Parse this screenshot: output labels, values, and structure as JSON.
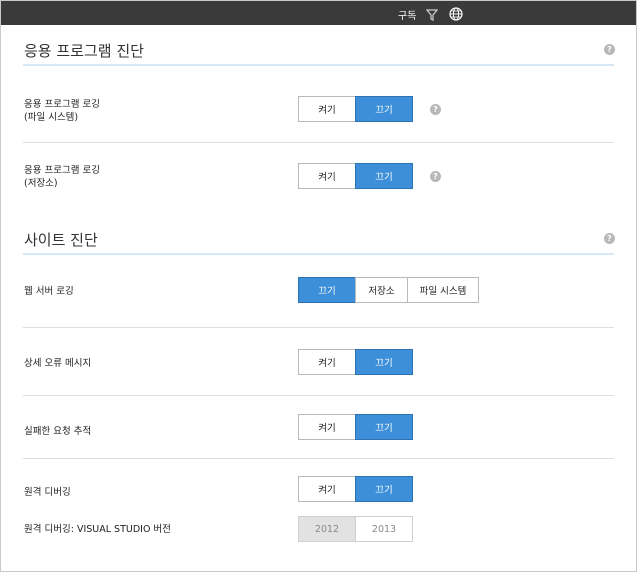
{
  "topbar": {
    "subscription_label": "구독"
  },
  "app_diag": {
    "title": "응용 프로그램 진단",
    "help": "?",
    "fs_logging": {
      "label_line1": "응용 프로그램 로깅",
      "label_line2": "(파일 시스템)",
      "on": "켜기",
      "off": "끄기",
      "selected": "off"
    },
    "blob_logging": {
      "label_line1": "응용 프로그램 로깅",
      "label_line2": "(저장소)",
      "on": "켜기",
      "off": "끄기",
      "selected": "off"
    }
  },
  "site_diag": {
    "title": "사이트 진단",
    "help": "?",
    "web_server_logging": {
      "label": "웹 서버 로깅",
      "opt_off": "끄기",
      "opt_storage": "저장소",
      "opt_fs": "파일 시스템",
      "selected": "off"
    },
    "detailed_errors": {
      "label": "상세 오류 메시지",
      "on": "켜기",
      "off": "끄기",
      "selected": "off"
    },
    "failed_request": {
      "label": "실패한 요청 추적",
      "on": "켜기",
      "off": "끄기",
      "selected": "off"
    },
    "remote_debugging": {
      "label": "원격 디버깅",
      "on": "켜기",
      "off": "끄기",
      "selected": "off"
    },
    "vs_version": {
      "label": "원격 디버깅: VISUAL STUDIO 버전",
      "v2012": "2012",
      "v2013": "2013",
      "state": "disabled"
    }
  },
  "colors": {
    "accent": "#3c8fd8",
    "topbar": "#3a3a3a",
    "section_line": "#d7e9f6"
  },
  "icons": [
    "filter-icon",
    "globe-icon",
    "help-icon"
  ]
}
